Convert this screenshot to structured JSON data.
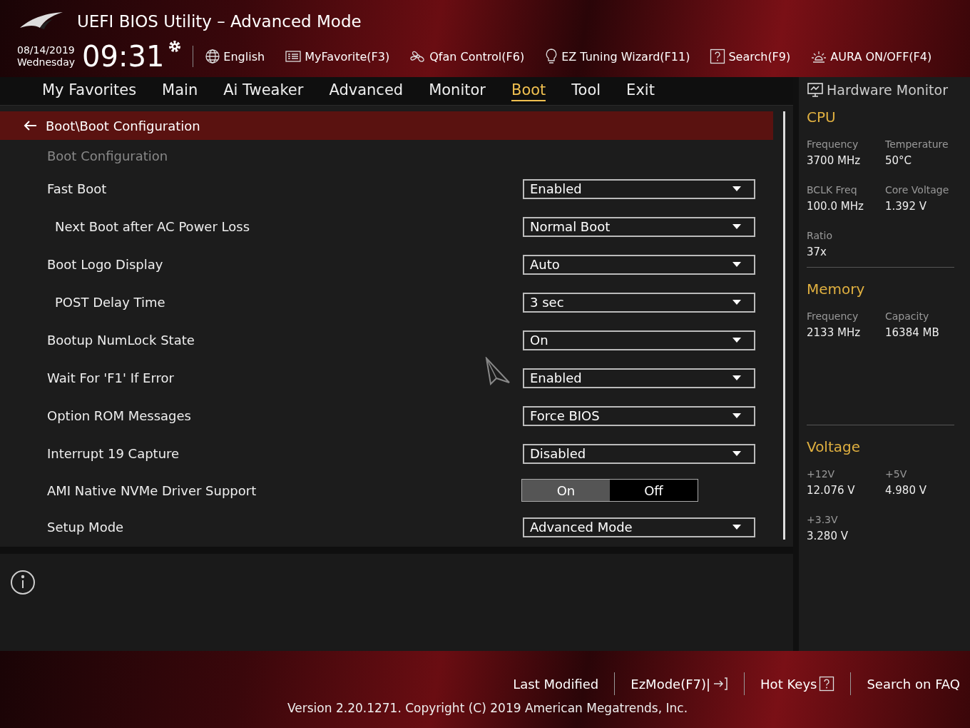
{
  "header": {
    "title": "UEFI BIOS Utility – Advanced Mode",
    "date": "08/14/2019",
    "weekday": "Wednesday",
    "time": "09:31",
    "tools": [
      {
        "kind": "globe",
        "label": "English"
      },
      {
        "kind": "favorite",
        "label": "MyFavorite(F3)"
      },
      {
        "kind": "fan",
        "label": "Qfan Control(F6)"
      },
      {
        "kind": "bulb",
        "label": "EZ Tuning Wizard(F11)"
      },
      {
        "kind": "help",
        "label": "Search(F9)"
      },
      {
        "kind": "aura",
        "label": "AURA ON/OFF(F4)"
      }
    ]
  },
  "tabs": [
    {
      "label": "My Favorites",
      "selected": false
    },
    {
      "label": "Main",
      "selected": false
    },
    {
      "label": "Ai Tweaker",
      "selected": false
    },
    {
      "label": "Advanced",
      "selected": false
    },
    {
      "label": "Monitor",
      "selected": false
    },
    {
      "label": "Boot",
      "selected": true
    },
    {
      "label": "Tool",
      "selected": false
    },
    {
      "label": "Exit",
      "selected": false
    }
  ],
  "breadcrumb": "Boot\\Boot Configuration",
  "section_title": "Boot Configuration",
  "settings": [
    {
      "kind": "dropdown",
      "label": "Fast Boot",
      "value": "Enabled",
      "children": [
        {
          "kind": "dropdown",
          "label": "Next Boot after AC Power Loss",
          "value": "Normal Boot"
        }
      ]
    },
    {
      "kind": "dropdown",
      "label": "Boot Logo Display",
      "value": "Auto",
      "children": [
        {
          "kind": "dropdown",
          "label": "POST Delay Time",
          "value": "3 sec"
        }
      ]
    },
    {
      "kind": "dropdown",
      "label": "Bootup NumLock State",
      "value": "On"
    },
    {
      "kind": "dropdown",
      "label": "Wait For 'F1' If Error",
      "value": "Enabled"
    },
    {
      "kind": "dropdown",
      "label": "Option ROM Messages",
      "value": "Force BIOS"
    },
    {
      "kind": "dropdown",
      "label": "Interrupt 19 Capture",
      "value": "Disabled"
    },
    {
      "kind": "toggle",
      "label": "AMI Native NVMe Driver Support",
      "options": [
        {
          "label": "On",
          "selected": true
        },
        {
          "label": "Off",
          "selected": false
        }
      ]
    },
    {
      "kind": "dropdown",
      "label": "Setup Mode",
      "value": "Advanced Mode"
    }
  ],
  "hardware_monitor": {
    "title": "Hardware Monitor",
    "groups": [
      {
        "title": "CPU",
        "items": [
          {
            "label": "Frequency",
            "value": "3700 MHz"
          },
          {
            "label": "Temperature",
            "value": "50°C"
          },
          {
            "label": "BCLK Freq",
            "value": "100.0 MHz"
          },
          {
            "label": "Core Voltage",
            "value": "1.392 V"
          },
          {
            "label": "Ratio",
            "value": "37x"
          }
        ]
      },
      {
        "title": "Memory",
        "items": [
          {
            "label": "Frequency",
            "value": "2133 MHz"
          },
          {
            "label": "Capacity",
            "value": "16384 MB"
          }
        ]
      },
      {
        "title": "Voltage",
        "items": [
          {
            "label": "+12V",
            "value": "12.076 V"
          },
          {
            "label": "+5V",
            "value": "4.980 V"
          },
          {
            "label": "+3.3V",
            "value": "3.280 V"
          }
        ]
      }
    ]
  },
  "footer": {
    "links": [
      {
        "kind": "plain",
        "label": "Last Modified"
      },
      {
        "kind": "exit",
        "label": "EzMode(F7)|"
      },
      {
        "kind": "help",
        "label": "Hot Keys"
      },
      {
        "kind": "plain",
        "label": "Search on FAQ"
      }
    ],
    "version": "Version 2.20.1271. Copyright (C) 2019 American Megatrends, Inc."
  }
}
